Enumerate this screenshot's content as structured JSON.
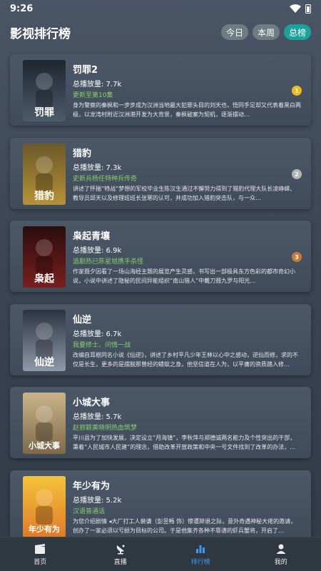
{
  "status_bar": {
    "time": "9:26"
  },
  "header": {
    "title": "影视排行榜",
    "tabs": [
      {
        "label": "今日",
        "active": false
      },
      {
        "label": "本周",
        "active": false
      },
      {
        "label": "总榜",
        "active": true
      }
    ]
  },
  "shows": [
    {
      "title": "罚罪2",
      "plays": "总播放量: 7.7k",
      "sub": "更新至第10集",
      "desc": "身为警察的秦枫和一步步成为汉洲当地最大犯罪头目的刘天也，悟同手足却又代表着黑白两极，以龙湾村附近汉洲港开发为大背景，秦枫破案为契机，逐渐摆动…",
      "rank": "1",
      "rank_color": "#f1b81f",
      "poster_text": "罚罪",
      "poster_colors": [
        "#1e2630",
        "#4d5b6b"
      ]
    },
    {
      "title": "猎豹",
      "plays": "总播放量: 7.3k",
      "sub": "史新兵杨任特种兵传奇",
      "desc": "讲述了怀揣“特战”梦想的军校毕业生陈汉生通过不懈努力得到了猎豹代理大队长凌峥嵘、教导员邱天以及修理班班长张寒的认可，并成功加入猎豹突击队，与一众…",
      "rank": "2",
      "rank_color": "#b5b5b5",
      "poster_text": "猎豹",
      "poster_colors": [
        "#6b5a2a",
        "#b69138"
      ]
    },
    {
      "title": "枭起青壤",
      "plays": "总播放量: 6.9k",
      "sub": "追剧热已陈星旭携手杀怪",
      "desc": "作家聂夕因看了一场山海经主题的展览产生灵感，书写出一部极具东方色彩的都市奇幻小说，小说中讲述了隐秘的民间异能组织“南山猎人”中戴刀聂九罗与阳光…",
      "rank": "3",
      "rank_color": "#c97a3a",
      "poster_text": "枭起",
      "poster_colors": [
        "#2a0d0d",
        "#7a1f1f"
      ]
    },
    {
      "title": "仙逆",
      "plays": "总播放量: 6.7k",
      "sub": "我要修士、问情一战",
      "desc": "改编自耳根同名小说《仙逆》，讲述了乡村平凡少年王林以心中之感动，逆仙而修，求的不仅是长生，更多的是摆脱那曾经的蝼蚁之身。他坚信道在人为，以平庸的资质踏入修…",
      "rank": "",
      "rank_color": "",
      "poster_text": "仙逆",
      "poster_colors": [
        "#2c3442",
        "#8f99a8"
      ]
    },
    {
      "title": "小城大事",
      "plays": "总播放量: 5.7k",
      "sub": "赵丽颖黄晓明热血筑梦",
      "desc": "平川县为了加快发展，决定设立“月海镇”，李秋萍与郑德诚两名能力及个性突出的干部，秉着“人民城市人民建”的理念，借助改革开放政策和中央一号文件找到了改革的办法，…",
      "rank": "",
      "rank_color": "",
      "poster_text": "小城大事",
      "poster_colors": [
        "#c9b48a",
        "#7e6a48"
      ]
    },
    {
      "title": "年少有为",
      "plays": "总播放量: 5.2k",
      "sub": "汉语普通话",
      "desc": "为您介绍剧情 ◂大厂打工人裴谦（彭昱畅 饰）惨遭辞退之际，意外奇遇神秘大佬的邀请，创办了一家必须以亏损为目标的公司。于是他集齐各种不靠谱的虾兵蟹将，开启了…",
      "rank": "",
      "rank_color": "",
      "poster_text": "年少有为",
      "poster_colors": [
        "#f3c33a",
        "#e07a2a"
      ]
    }
  ],
  "nav": [
    {
      "label": "首页",
      "active": false
    },
    {
      "label": "直播",
      "active": false
    },
    {
      "label": "排行榜",
      "active": true
    },
    {
      "label": "我的",
      "active": false
    }
  ]
}
